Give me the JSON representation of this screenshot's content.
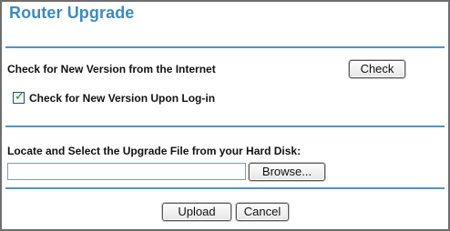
{
  "page": {
    "title": "Router Upgrade"
  },
  "online_check": {
    "label": "Check for New Version from the Internet",
    "check_button": "Check",
    "login_checkbox_label": "Check for New Version Upon Log-in",
    "login_checkbox_checked": true
  },
  "file_upload": {
    "label": "Locate and Select the Upgrade File from your Hard Disk:",
    "file_value": "",
    "browse_button": "Browse..."
  },
  "actions": {
    "upload_button": "Upload",
    "cancel_button": "Cancel"
  },
  "colors": {
    "title": "#3a8bbf",
    "divider": "#4f97c6"
  }
}
